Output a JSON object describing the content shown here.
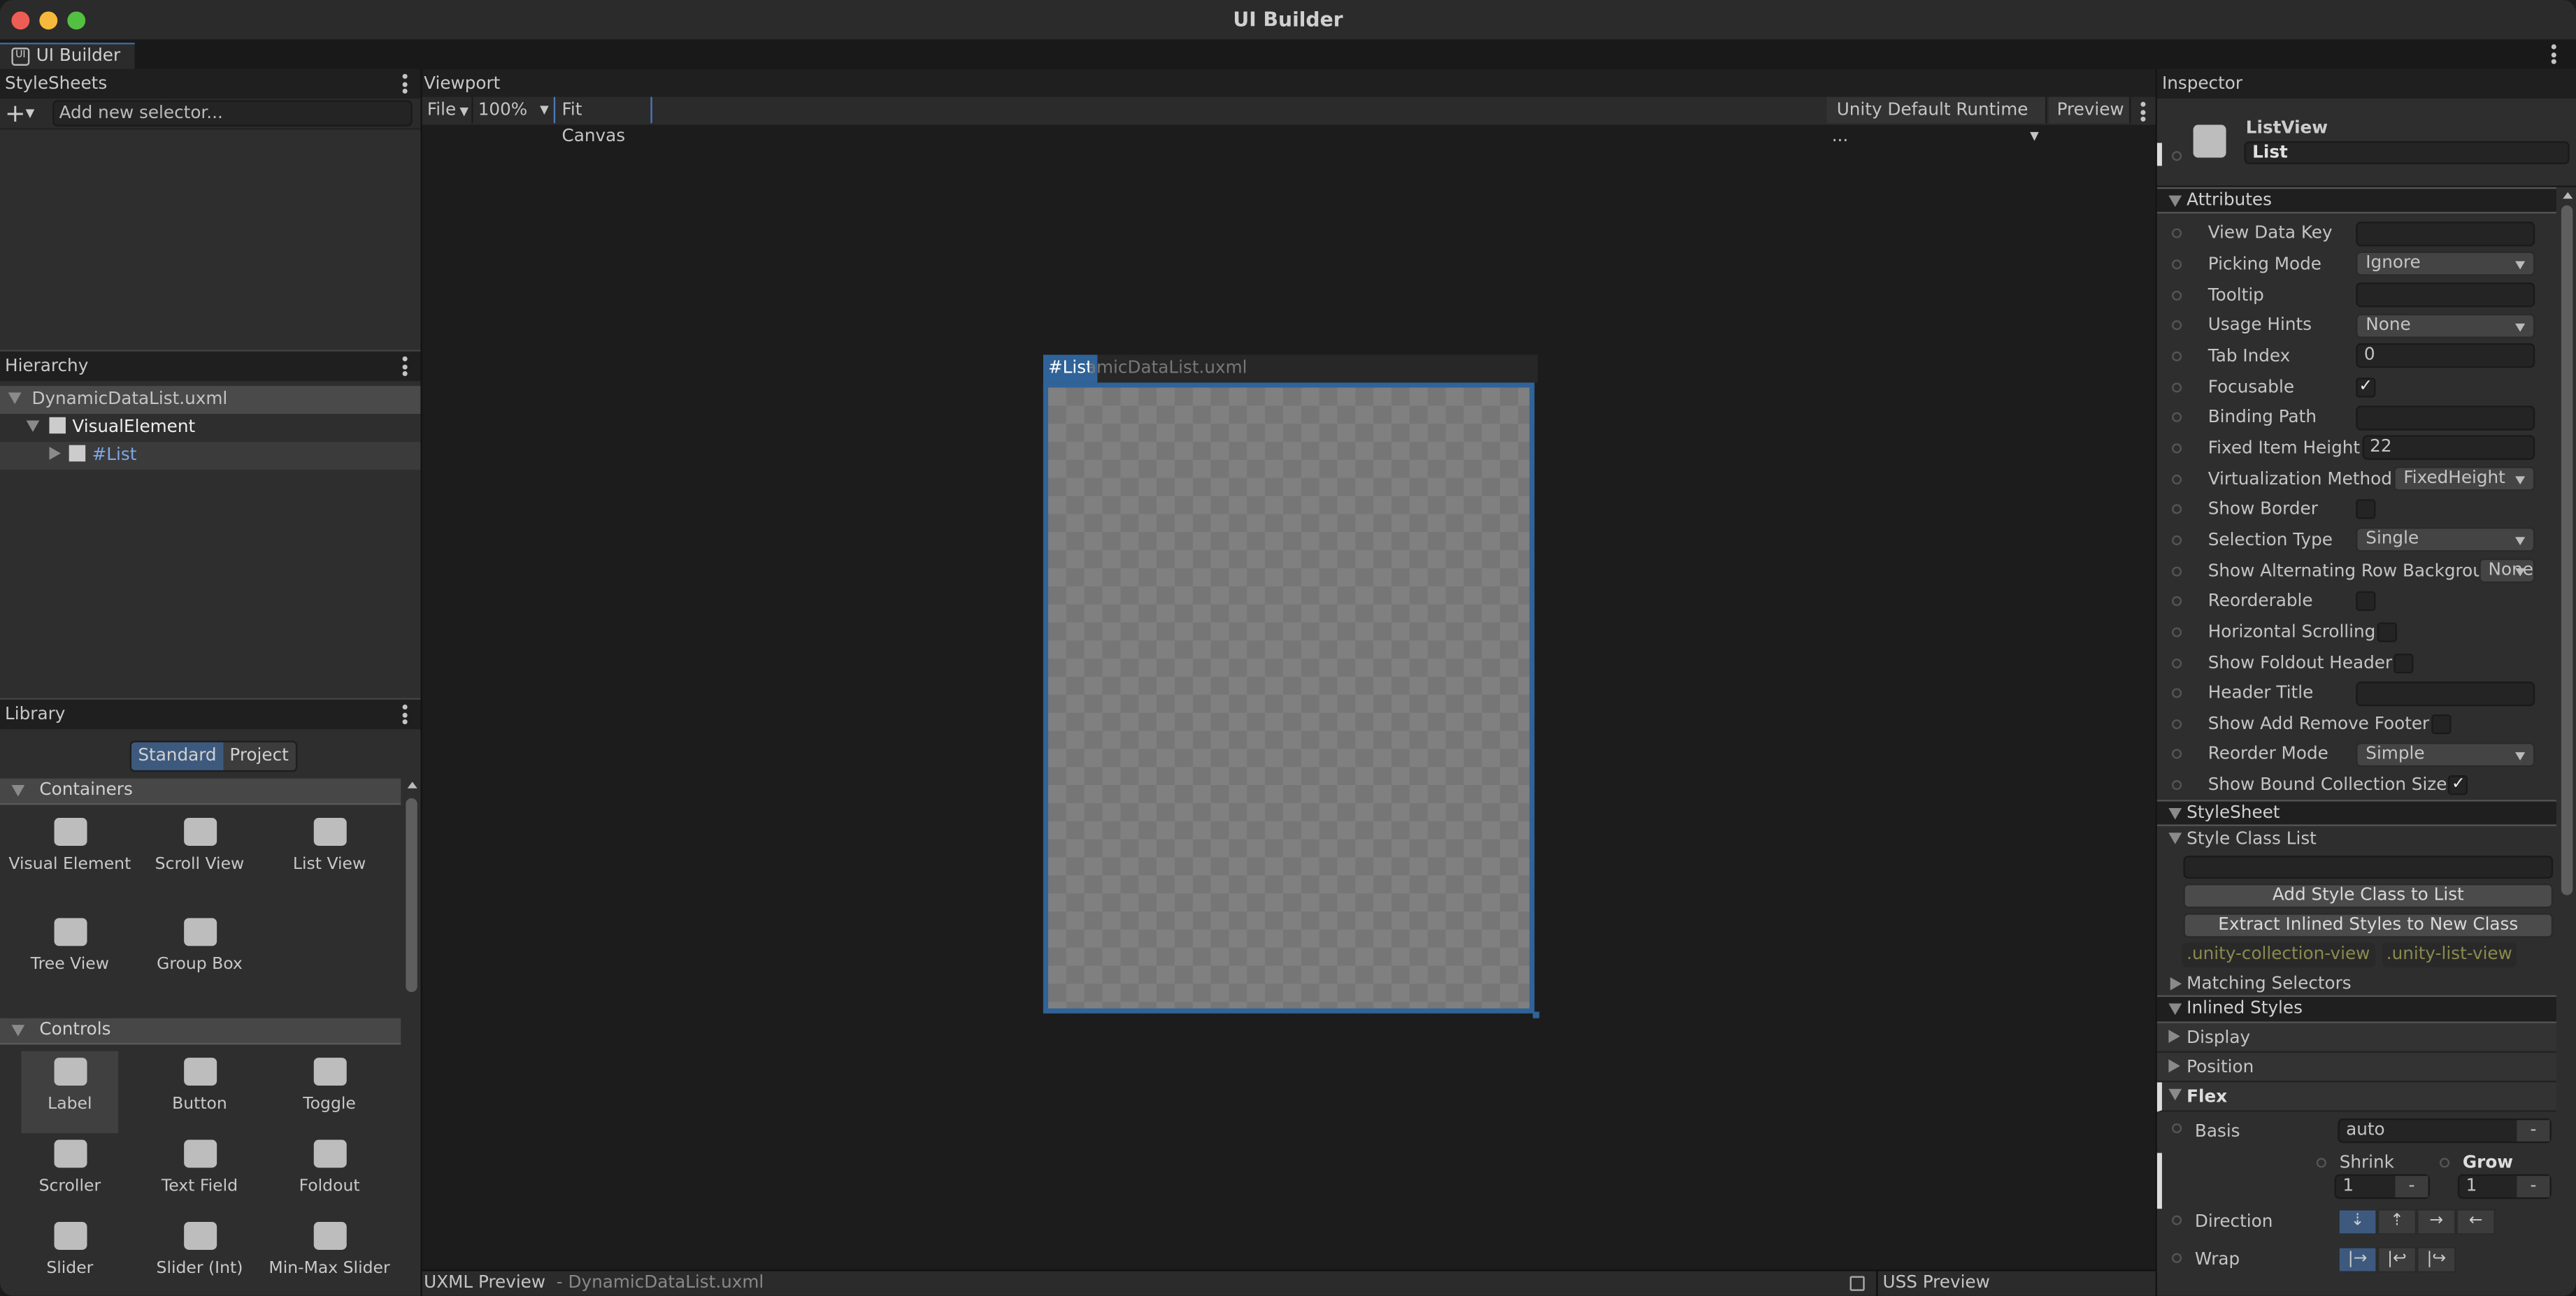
{
  "window": {
    "title": "UI Builder",
    "tab_label": "UI Builder"
  },
  "stylesheets": {
    "title": "StyleSheets",
    "selector_placeholder": "Add new selector..."
  },
  "hierarchy": {
    "title": "Hierarchy",
    "items": [
      {
        "label": "DynamicDataList.uxml"
      },
      {
        "label": "VisualElement"
      },
      {
        "label": "#List"
      }
    ]
  },
  "library": {
    "title": "Library",
    "tabs": [
      "Standard",
      "Project"
    ],
    "active_tab": "Standard",
    "sections": [
      {
        "title": "Containers",
        "items": [
          {
            "label": "Visual Element",
            "icon": "visual-element-icon"
          },
          {
            "label": "Scroll View",
            "icon": "scroll-view-icon"
          },
          {
            "label": "List View",
            "icon": "list-view-icon"
          },
          {
            "label": "Tree View",
            "icon": "tree-view-icon"
          },
          {
            "label": "Group Box",
            "icon": "group-box-icon"
          }
        ]
      },
      {
        "title": "Controls",
        "items": [
          {
            "label": "Label",
            "icon": "label-icon"
          },
          {
            "label": "Button",
            "icon": "button-icon"
          },
          {
            "label": "Toggle",
            "icon": "toggle-icon"
          },
          {
            "label": "Scroller",
            "icon": "scroller-icon"
          },
          {
            "label": "Text Field",
            "icon": "text-field-icon"
          },
          {
            "label": "Foldout",
            "icon": "foldout-icon"
          },
          {
            "label": "Slider",
            "icon": "slider-icon"
          },
          {
            "label": "Slider (Int)",
            "icon": "slider-int-icon"
          },
          {
            "label": "Min-Max Slider",
            "icon": "min-max-slider-icon"
          }
        ]
      }
    ]
  },
  "viewport": {
    "title": "Viewport",
    "file": "File",
    "zoom": "100%",
    "fit": "Fit Canvas",
    "theme": "Unity Default Runtime ...",
    "preview": "Preview",
    "canvas_badge": "#List",
    "canvas_title": "DynamicDataList.uxml"
  },
  "bottom": {
    "uxml": "UXML Preview",
    "uxml_file": "- DynamicDataList.uxml",
    "uss": "USS Preview"
  },
  "inspector": {
    "title": "Inspector",
    "element_type": "ListView",
    "element_name": "List",
    "attributes_title": "Attributes",
    "attributes": [
      {
        "label": "View Data Key",
        "type": "text",
        "value": ""
      },
      {
        "label": "Picking Mode",
        "type": "dropdown",
        "value": "Ignore"
      },
      {
        "label": "Tooltip",
        "type": "text",
        "value": ""
      },
      {
        "label": "Usage Hints",
        "type": "dropdown",
        "value": "None"
      },
      {
        "label": "Tab Index",
        "type": "text",
        "value": "0"
      },
      {
        "label": "Focusable",
        "type": "checkbox",
        "checked": true
      },
      {
        "label": "Binding Path",
        "type": "text",
        "value": ""
      },
      {
        "label": "Fixed Item Height",
        "type": "text",
        "value": "22"
      },
      {
        "label": "Virtualization Method",
        "type": "dropdown",
        "value": "FixedHeight"
      },
      {
        "label": "Show Border",
        "type": "checkbox",
        "checked": false
      },
      {
        "label": "Selection Type",
        "type": "dropdown",
        "value": "Single"
      },
      {
        "label": "Show Alternating Row Backgrounds",
        "type": "dropdown",
        "value": "None"
      },
      {
        "label": "Reorderable",
        "type": "checkbox",
        "checked": false
      },
      {
        "label": "Horizontal Scrolling",
        "type": "checkbox",
        "checked": false
      },
      {
        "label": "Show Foldout Header",
        "type": "checkbox",
        "checked": false
      },
      {
        "label": "Header Title",
        "type": "text",
        "value": ""
      },
      {
        "label": "Show Add Remove Footer",
        "type": "checkbox",
        "checked": false
      },
      {
        "label": "Reorder Mode",
        "type": "dropdown",
        "value": "Simple"
      },
      {
        "label": "Show Bound Collection Size",
        "type": "checkbox",
        "checked": true
      }
    ],
    "stylesheet_title": "StyleSheet",
    "style_class_list": "Style Class List",
    "add_class_btn": "Add Style Class to List",
    "extract_btn": "Extract Inlined Styles to New Class",
    "classes": [
      ".unity-collection-view",
      ".unity-list-view"
    ],
    "matching": "Matching Selectors",
    "inlined": "Inlined Styles",
    "display": "Display",
    "position": "Position",
    "flex": "Flex",
    "basis_label": "Basis",
    "basis_value": "auto",
    "shrink_label": "Shrink",
    "shrink_value": "1",
    "grow_label": "Grow",
    "grow_value": "1",
    "direction_label": "Direction",
    "wrap_label": "Wrap",
    "unset": "-"
  },
  "colors": {
    "accent": "#3d5a7e",
    "selection": "#2f6399",
    "class_tag": "#8a8a4e"
  }
}
